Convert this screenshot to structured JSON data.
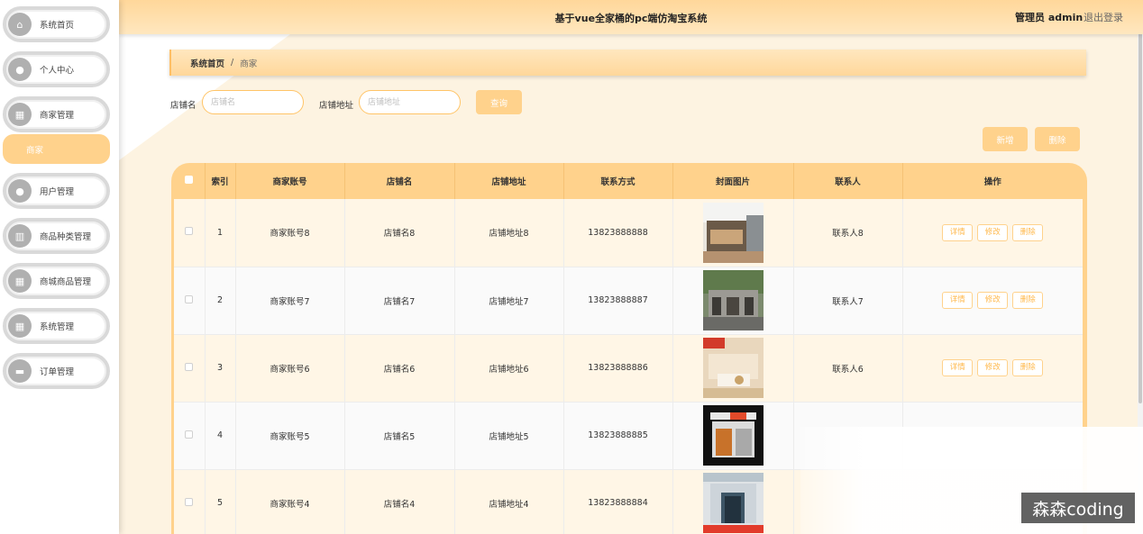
{
  "sidebar": {
    "items": [
      {
        "label": "系统首页",
        "icon": "home-icon",
        "glyph": "⌂"
      },
      {
        "label": "个人中心",
        "icon": "user-icon",
        "glyph": "●"
      },
      {
        "label": "商家管理",
        "icon": "grid-icon",
        "glyph": "▦"
      },
      {
        "label": "用户管理",
        "icon": "user-icon",
        "glyph": "●"
      },
      {
        "label": "商品种类管理",
        "icon": "book-icon",
        "glyph": "▥"
      },
      {
        "label": "商城商品管理",
        "icon": "apps-icon",
        "glyph": "▦"
      },
      {
        "label": "系统管理",
        "icon": "apps-icon",
        "glyph": "▦"
      },
      {
        "label": "订单管理",
        "icon": "briefcase-icon",
        "glyph": "▬"
      }
    ],
    "active_sub": "商家"
  },
  "header": {
    "title": "基于vue全家桶的pc端仿淘宝系统",
    "admin": "管理员 admin",
    "logout": "退出登录"
  },
  "breadcrumb": {
    "home": "系统首页",
    "separator": "/",
    "current": "商家"
  },
  "search": {
    "shop_name_label": "店铺名",
    "shop_name_placeholder": "店铺名",
    "address_label": "店铺地址",
    "address_placeholder": "店铺地址",
    "query_button": "查询"
  },
  "actions": {
    "add": "新增",
    "delete": "删除"
  },
  "table": {
    "headers": [
      "",
      "索引",
      "商家账号",
      "店铺名",
      "店铺地址",
      "联系方式",
      "封面图片",
      "联系人",
      "操作"
    ],
    "op_labels": {
      "detail": "详情",
      "edit": "修改",
      "delete": "删除"
    },
    "rows": [
      {
        "index": "1",
        "account": "商家账号8",
        "name": "店铺名8",
        "address": "店铺地址8",
        "phone": "13823888888",
        "contact": "联系人8"
      },
      {
        "index": "2",
        "account": "商家账号7",
        "name": "店铺名7",
        "address": "店铺地址7",
        "phone": "13823888887",
        "contact": "联系人7"
      },
      {
        "index": "3",
        "account": "商家账号6",
        "name": "店铺名6",
        "address": "店铺地址6",
        "phone": "13823888886",
        "contact": "联系人6"
      },
      {
        "index": "4",
        "account": "商家账号5",
        "name": "店铺名5",
        "address": "店铺地址5",
        "phone": "13823888885",
        "contact": ""
      },
      {
        "index": "5",
        "account": "商家账号4",
        "name": "店铺名4",
        "address": "店铺地址4",
        "phone": "13823888884",
        "contact": ""
      }
    ]
  },
  "watermark": "森森coding",
  "colors": {
    "accent": "#ffd28c",
    "accent_text": "#ffb94d",
    "bg": "#fdf3e1"
  }
}
